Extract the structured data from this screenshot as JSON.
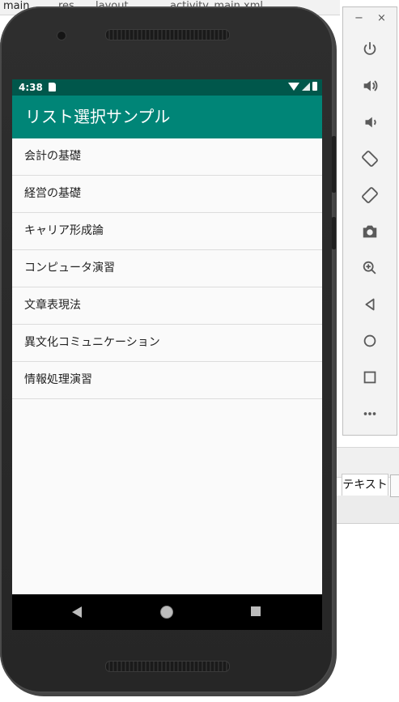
{
  "ide": {
    "crumbs": [
      "main",
      "res",
      "layout",
      "activity_main.xml"
    ],
    "tab_text": "テキスト"
  },
  "device": {
    "status_time": "4:38",
    "app_title": "リスト選択サンプル",
    "list_items": [
      "会計の基礎",
      "経営の基礎",
      "キャリア形成論",
      "コンピュータ演習",
      "文章表現法",
      "異文化コミュニケーション",
      "情報処理演習"
    ],
    "colors": {
      "status_bar": "#00574b",
      "app_bar": "#008577",
      "list_bg": "#fafafa"
    }
  },
  "emulator_toolbar": {
    "minimize": "−",
    "close": "×",
    "buttons": [
      "power-icon",
      "volume-up-icon",
      "volume-down-icon",
      "rotate-left-icon",
      "rotate-right-icon",
      "camera-icon",
      "zoom-icon",
      "back-icon",
      "home-icon",
      "overview-icon",
      "more-icon"
    ]
  }
}
